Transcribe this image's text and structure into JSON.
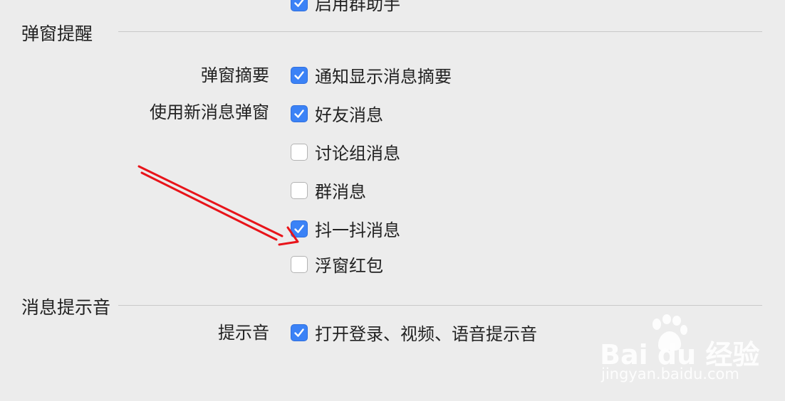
{
  "top_partial": {
    "label": "启用群助手",
    "checked": true
  },
  "popup_section": {
    "title": "弹窗提醒",
    "summary_label": "弹窗摘要",
    "summary_option": {
      "label": "通知显示消息摘要",
      "checked": true
    },
    "new_msg_label": "使用新消息弹窗",
    "new_msg_options": [
      {
        "label": "好友消息",
        "checked": true
      },
      {
        "label": "讨论组消息",
        "checked": false
      },
      {
        "label": "群消息",
        "checked": false
      },
      {
        "label": "抖一抖消息",
        "checked": true
      },
      {
        "label": "浮窗红包",
        "checked": false
      }
    ]
  },
  "sound_section": {
    "title": "消息提示音",
    "sound_label": "提示音",
    "sound_option": {
      "label": "打开登录、视频、语音提示音",
      "checked": true
    }
  },
  "watermark": {
    "brand": "Bai du 经验",
    "url": "jingyan.baidu.com"
  },
  "colors": {
    "background": "#ececec",
    "checkbox_checked": "#3b82f6",
    "annotation_arrow": "#e8141a"
  }
}
